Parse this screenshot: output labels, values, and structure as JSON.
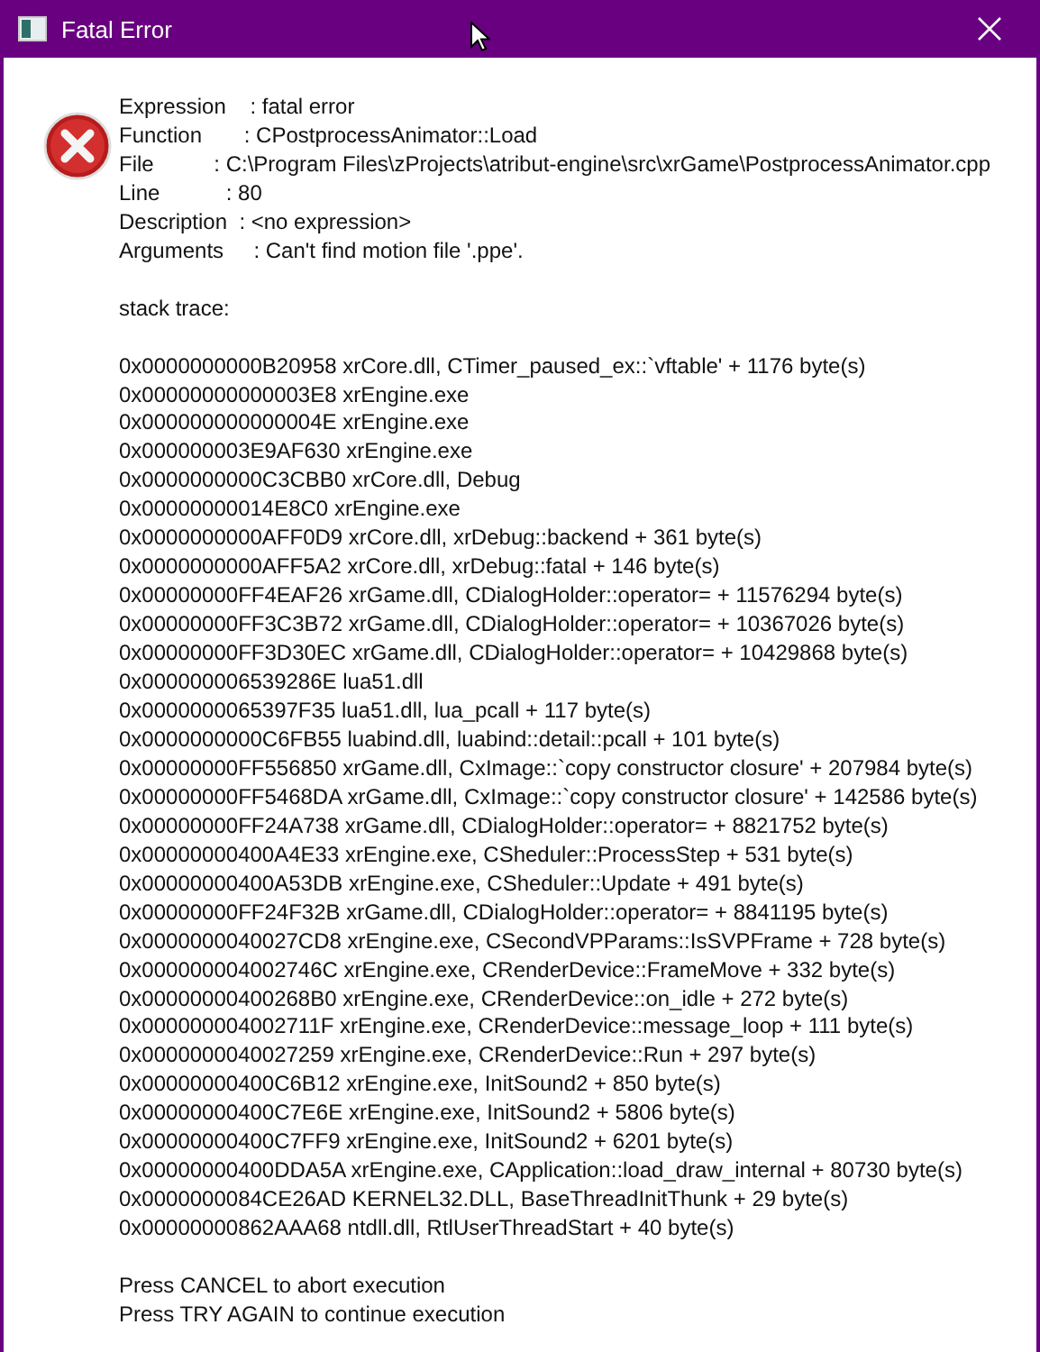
{
  "window": {
    "title": "Fatal Error"
  },
  "details": [
    "Expression    : fatal error",
    "Function       : CPostprocessAnimator::Load",
    "File          : C:\\Program Files\\zProjects\\atribut-engine\\src\\xrGame\\PostprocessAnimator.cpp",
    "Line           : 80",
    "Description  : <no expression>",
    "Arguments     : Can't find motion file '.ppe'."
  ],
  "stack_heading": "stack trace:",
  "stack_trace": [
    "0x0000000000B20958 xrCore.dll, CTimer_paused_ex::`vftable' + 1176 byte(s)",
    "0x00000000000003E8 xrEngine.exe",
    "0x000000000000004E xrEngine.exe",
    "0x000000003E9AF630 xrEngine.exe",
    "0x0000000000C3CBB0 xrCore.dll, Debug",
    "0x00000000014E8C0 xrEngine.exe",
    "0x0000000000AFF0D9 xrCore.dll, xrDebug::backend + 361 byte(s)",
    "0x0000000000AFF5A2 xrCore.dll, xrDebug::fatal + 146 byte(s)",
    "0x00000000FF4EAF26 xrGame.dll, CDialogHolder::operator= + 11576294 byte(s)",
    "0x00000000FF3C3B72 xrGame.dll, CDialogHolder::operator= + 10367026 byte(s)",
    "0x00000000FF3D30EC xrGame.dll, CDialogHolder::operator= + 10429868 byte(s)",
    "0x000000006539286E lua51.dll",
    "0x0000000065397F35 lua51.dll, lua_pcall + 117 byte(s)",
    "0x0000000000C6FB55 luabind.dll, luabind::detail::pcall + 101 byte(s)",
    "0x00000000FF556850 xrGame.dll, CxImage::`copy constructor closure' + 207984 byte(s)",
    "0x00000000FF5468DA xrGame.dll, CxImage::`copy constructor closure' + 142586 byte(s)",
    "0x00000000FF24A738 xrGame.dll, CDialogHolder::operator= + 8821752 byte(s)",
    "0x00000000400A4E33 xrEngine.exe, CSheduler::ProcessStep + 531 byte(s)",
    "0x00000000400A53DB xrEngine.exe, CSheduler::Update + 491 byte(s)",
    "0x00000000FF24F32B xrGame.dll, CDialogHolder::operator= + 8841195 byte(s)",
    "0x0000000040027CD8 xrEngine.exe, CSecondVPParams::IsSVPFrame + 728 byte(s)",
    "0x000000004002746C xrEngine.exe, CRenderDevice::FrameMove + 332 byte(s)",
    "0x00000000400268B0 xrEngine.exe, CRenderDevice::on_idle + 272 byte(s)",
    "0x000000004002711F xrEngine.exe, CRenderDevice::message_loop + 111 byte(s)",
    "0x0000000040027259 xrEngine.exe, CRenderDevice::Run + 297 byte(s)",
    "0x00000000400C6B12 xrEngine.exe, InitSound2 + 850 byte(s)",
    "0x00000000400C7E6E xrEngine.exe, InitSound2 + 5806 byte(s)",
    "0x00000000400C7FF9 xrEngine.exe, InitSound2 + 6201 byte(s)",
    "0x00000000400DDA5A xrEngine.exe, CApplication::load_draw_internal + 80730 byte(s)",
    "0x0000000084CE26AD KERNEL32.DLL, BaseThreadInitThunk + 29 byte(s)",
    "0x00000000862AAA68 ntdll.dll, RtlUserThreadStart + 40 byte(s)"
  ],
  "prompts": [
    "Press CANCEL to abort execution",
    "Press TRY AGAIN to continue execution"
  ]
}
